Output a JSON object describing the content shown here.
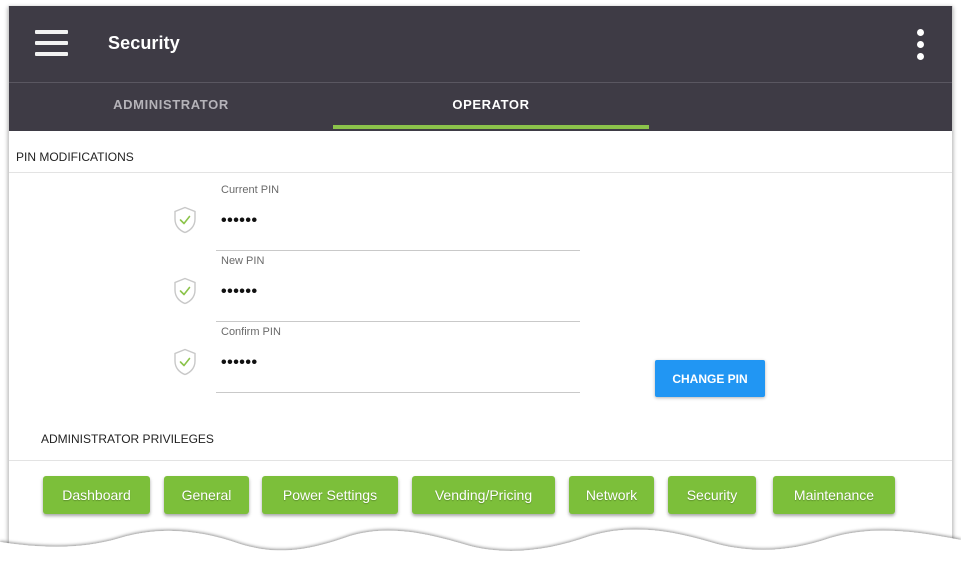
{
  "appbar": {
    "title": "Security",
    "menu_icon": "hamburger-menu-icon",
    "overflow_icon": "more-vertical-icon"
  },
  "tabs": [
    {
      "label": "ADMINISTRATOR",
      "active": false
    },
    {
      "label": "OPERATOR",
      "active": true
    }
  ],
  "pin_section": {
    "heading": "PIN MODIFICATIONS",
    "fields": [
      {
        "label": "Current PIN",
        "value": "••••••",
        "icon": "shield-check-icon"
      },
      {
        "label": "New PIN",
        "value": "••••••",
        "icon": "shield-check-icon"
      },
      {
        "label": "Confirm PIN",
        "value": "••••••",
        "icon": "shield-check-icon"
      }
    ],
    "change_button": "CHANGE PIN"
  },
  "privileges": {
    "heading": "ADMINISTRATOR PRIVILEGES",
    "items": [
      "Dashboard",
      "General",
      "Power Settings",
      "Vending/Pricing",
      "Network",
      "Security",
      "Maintenance"
    ]
  },
  "colors": {
    "appbar": "#3e3b45",
    "tab_indicator": "#8bc34a",
    "primary_button": "#2196f3",
    "chip": "#7cbf3a"
  }
}
